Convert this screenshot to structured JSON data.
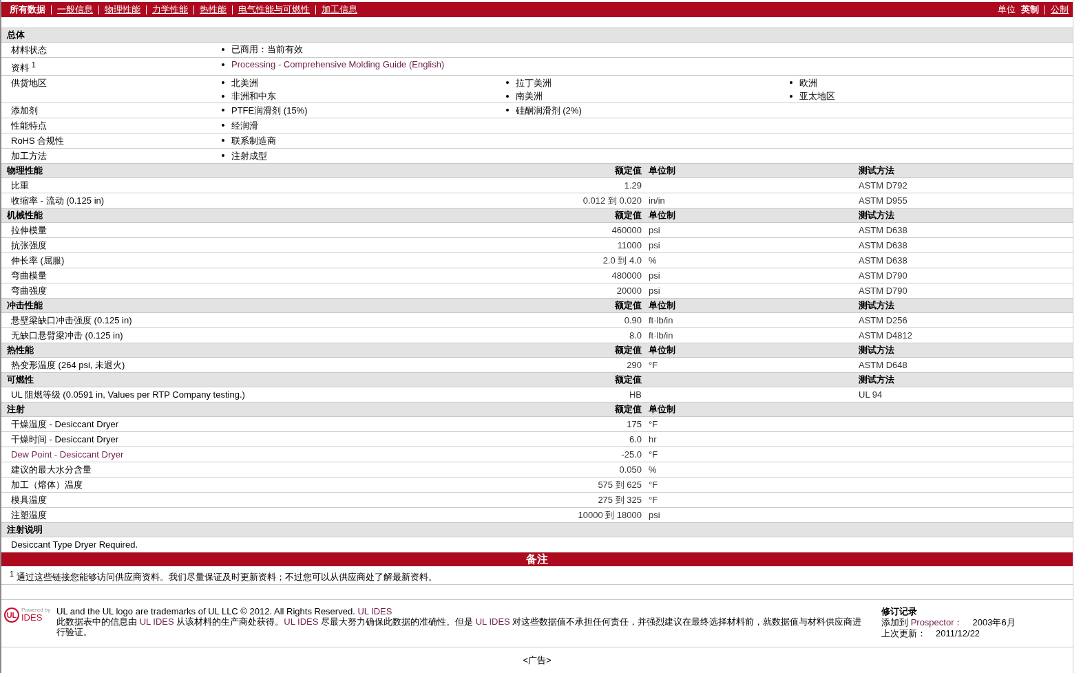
{
  "nav": {
    "tabs": [
      {
        "label": "所有数据",
        "selected": true
      },
      {
        "label": "一般信息",
        "selected": false
      },
      {
        "label": "物理性能",
        "selected": false
      },
      {
        "label": "力学性能",
        "selected": false
      },
      {
        "label": "热性能",
        "selected": false
      },
      {
        "label": "电气性能与可燃性",
        "selected": false
      },
      {
        "label": "加工信息",
        "selected": false
      }
    ],
    "units_label": "单位",
    "units": [
      {
        "label": "英制",
        "selected": true
      },
      {
        "label": "公制",
        "selected": false
      }
    ]
  },
  "general": {
    "title": "总体",
    "rows": [
      {
        "label": "材料状态",
        "items": [
          {
            "text": "已商用：当前有效"
          }
        ]
      },
      {
        "label": "资料 $^{1}$",
        "items": [
          {
            "text": "Processing - Comprehensive Molding Guide (English)",
            "link": true
          }
        ]
      },
      {
        "label": "供货地区",
        "items": [
          {
            "text": "北美洲"
          },
          {
            "text": "拉丁美洲"
          },
          {
            "text": "欧洲"
          },
          {
            "text": "非洲和中东"
          },
          {
            "text": "南美洲"
          },
          {
            "text": "亚太地区"
          }
        ]
      },
      {
        "label": "添加剂",
        "items": [
          {
            "text": "PTFE润滑剂 (15%)"
          },
          {
            "text": "硅酮润滑剂 (2%)"
          }
        ]
      },
      {
        "label": "性能特点",
        "items": [
          {
            "text": "经润滑"
          }
        ]
      },
      {
        "label": "RoHS 合规性",
        "items": [
          {
            "text": "联系制造商"
          }
        ]
      },
      {
        "label": "加工方法",
        "items": [
          {
            "text": "注射成型"
          }
        ]
      }
    ]
  },
  "sections": [
    {
      "title": "物理性能",
      "headers": {
        "value": "额定值",
        "unit": "单位制",
        "method": "测试方法"
      },
      "rows": [
        {
          "label": "比重",
          "value": "1.29",
          "method": "ASTM D792"
        },
        {
          "label": "收缩率 - 流动 (0.125 in)",
          "value": "0.012 到  0.020",
          "unit": "in/in",
          "method": "ASTM D955"
        }
      ]
    },
    {
      "title": "机械性能",
      "headers": {
        "value": "额定值",
        "unit": "单位制",
        "method": "测试方法"
      },
      "rows": [
        {
          "label": "拉伸模量",
          "value": "460000",
          "unit": "psi",
          "method": "ASTM D638"
        },
        {
          "label": "抗张强度",
          "value": "11000",
          "unit": "psi",
          "method": "ASTM D638"
        },
        {
          "label": "伸长率 (屈服)",
          "value": "2.0 到  4.0",
          "unit": "%",
          "method": "ASTM D638"
        },
        {
          "label": "弯曲模量",
          "value": "480000",
          "unit": "psi",
          "method": "ASTM D790"
        },
        {
          "label": "弯曲强度",
          "value": "20000",
          "unit": "psi",
          "method": "ASTM D790"
        }
      ]
    },
    {
      "title": "冲击性能",
      "headers": {
        "value": "额定值",
        "unit": "单位制",
        "method": "测试方法"
      },
      "rows": [
        {
          "label": "悬壁梁缺口冲击强度 (0.125 in)",
          "value": "0.90",
          "unit": "ft·lb/in",
          "method": "ASTM D256"
        },
        {
          "label": "无缺口悬臂梁冲击 (0.125 in)",
          "value": "8.0",
          "unit": "ft·lb/in",
          "method": "ASTM D4812"
        }
      ]
    },
    {
      "title": "热性能",
      "headers": {
        "value": "额定值",
        "unit": "单位制",
        "method": "测试方法"
      },
      "rows": [
        {
          "label": "热变形温度 (264 psi, 未退火)",
          "value": "290",
          "unit": "°F",
          "method": "ASTM D648"
        }
      ]
    },
    {
      "title": "可燃性",
      "headers": {
        "value": "额定值",
        "method": "测试方法"
      },
      "rows": [
        {
          "label": "UL 阻燃等级 (0.0591 in, Values per RTP Company testing.)",
          "value": "HB",
          "method": "UL 94"
        }
      ]
    },
    {
      "title": "注射",
      "headers": {
        "value": "额定值",
        "unit": "单位制"
      },
      "rows": [
        {
          "label": "干燥温度 - Desiccant Dryer",
          "value": "175",
          "unit": "°F"
        },
        {
          "label": "干燥时间 - Desiccant Dryer",
          "value": "6.0",
          "unit": "hr"
        },
        {
          "label": "Dew Point - Desiccant Dryer",
          "value": "-25.0",
          "unit": "°F",
          "link": true
        },
        {
          "label": "建议的最大水分含量",
          "value": "0.050",
          "unit": "%"
        },
        {
          "label": "加工（熔体）温度",
          "value": "575 到  625",
          "unit": "°F"
        },
        {
          "label": "模具温度",
          "value": "275 到  325",
          "unit": "°F"
        },
        {
          "label": "注塑温度",
          "value": "10000 到  18000",
          "unit": "psi"
        }
      ]
    },
    {
      "title": "注射说明",
      "rows": [
        {
          "label": "Desiccant Type Dryer Required."
        }
      ]
    }
  ],
  "notes": {
    "title": "备注",
    "footnote": "$^{1}$ 通过这些链接您能够访问供应商资料。我们尽量保证及时更新资料；不过您可以从供应商处了解最新资料。"
  },
  "footer": {
    "logo": {
      "mark": "UL",
      "tag": "Powered by",
      "name": "IDES"
    },
    "trademark": [
      {
        "text": "UL and the UL logo are trademarks of UL LLC © 2012. All Rights Reserved. "
      },
      {
        "text": "UL IDES",
        "link": true
      }
    ],
    "disclaimer": [
      {
        "text": "此数据表中的信息由 "
      },
      {
        "text": "UL IDES",
        "link": true
      },
      {
        "text": " 从该材料的生产商处获得。"
      },
      {
        "text": "UL IDES",
        "link": true
      },
      {
        "text": " 尽最大努力确保此数据的准确性。但是 "
      },
      {
        "text": "UL IDES",
        "link": true
      },
      {
        "text": " 对这些数据值不承担任何责任，并强烈建议在最终选择材料前，就数据值与材料供应商进行验证。"
      }
    ],
    "revision": {
      "title": "修订记录",
      "rows": [
        {
          "parts": [
            {
              "text": "添加到 "
            },
            {
              "text": "Prospector：",
              "link": true
            }
          ],
          "value": "2003年6月"
        },
        {
          "parts": [
            {
              "text": "上次更新："
            }
          ],
          "value": "2011/12/22"
        }
      ]
    }
  },
  "ad": "<广告>"
}
